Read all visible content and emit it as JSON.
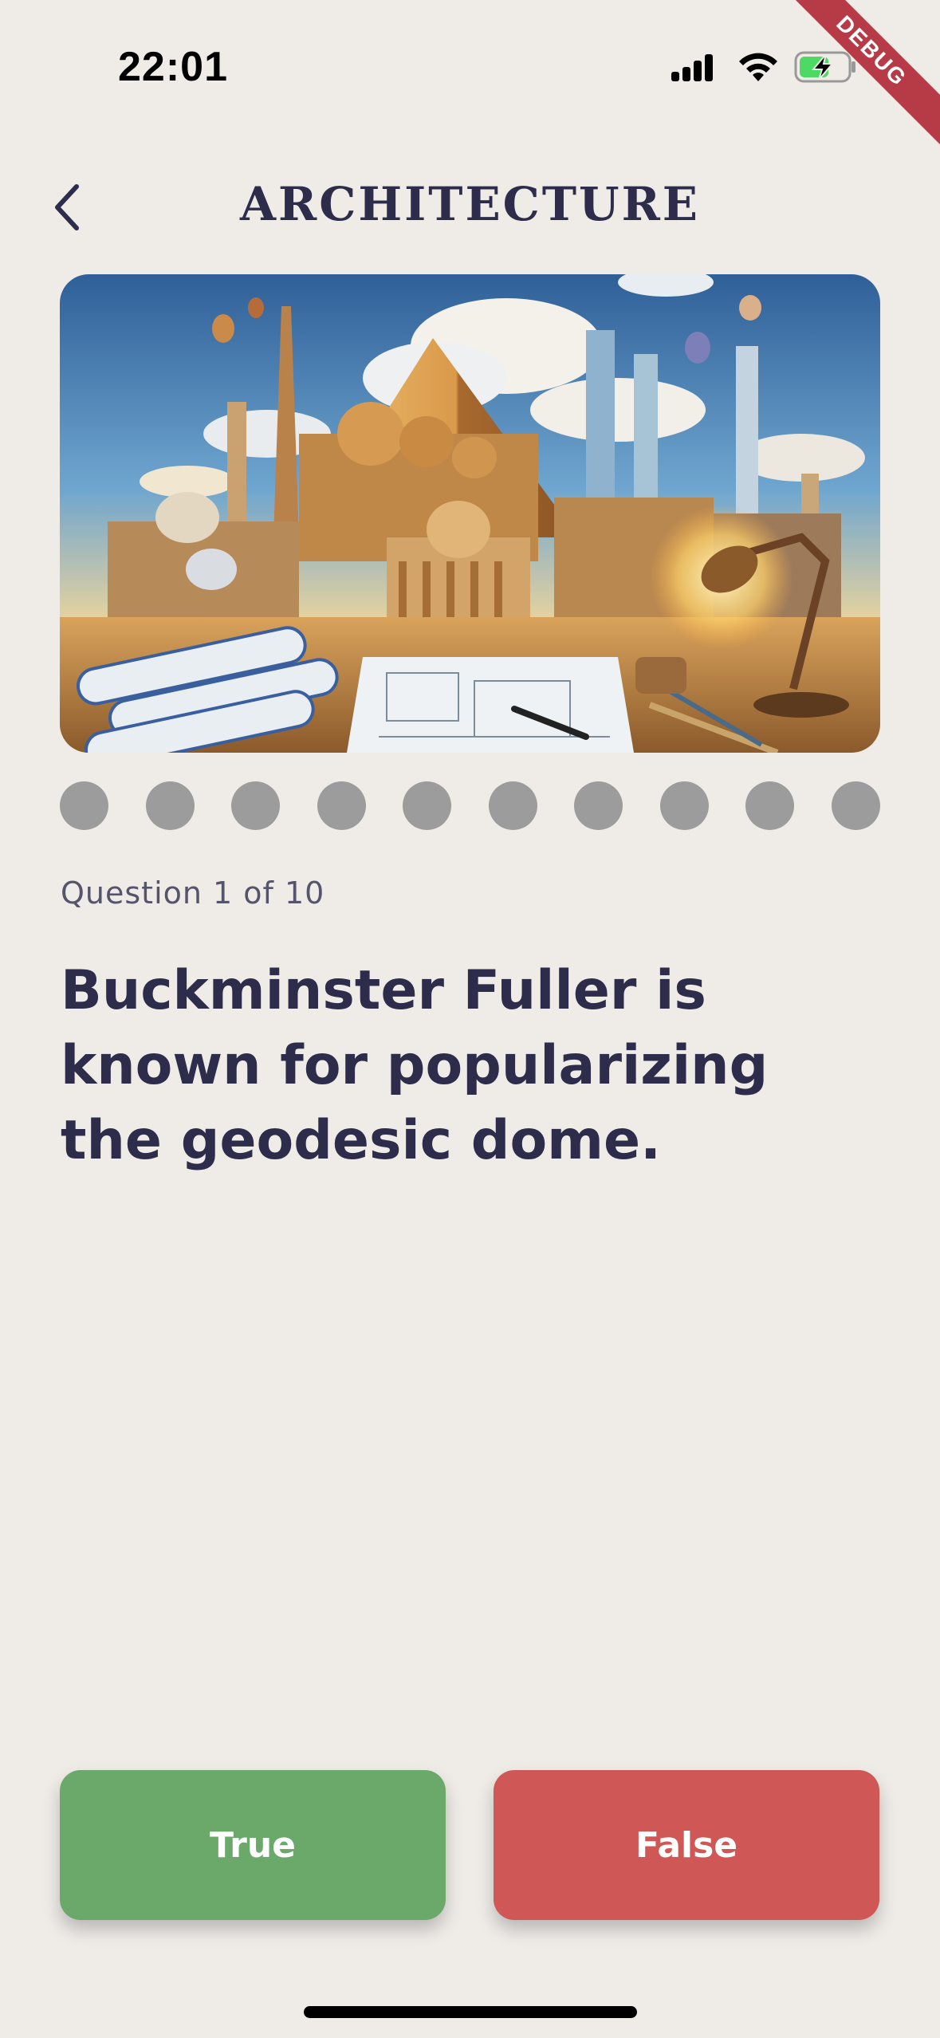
{
  "status_bar": {
    "time": "22:01"
  },
  "debug_banner": "DEBUG",
  "header": {
    "back_icon": "chevron-left-icon",
    "title": "ARCHITECTURE"
  },
  "hero_image": {
    "subject": "architecture-landmarks-illustration"
  },
  "progress": {
    "total": 10,
    "dot_color": "#9c9c9c"
  },
  "question": {
    "counter": "Question 1 of 10",
    "text": "Buckminster Fuller is known for popularizing the geodesic dome."
  },
  "answers": {
    "true_label": "True",
    "false_label": "False",
    "true_color": "#6aa96a",
    "false_color": "#cf5756"
  },
  "colors": {
    "background": "#efece8",
    "text_primary": "#2d2c4a"
  }
}
